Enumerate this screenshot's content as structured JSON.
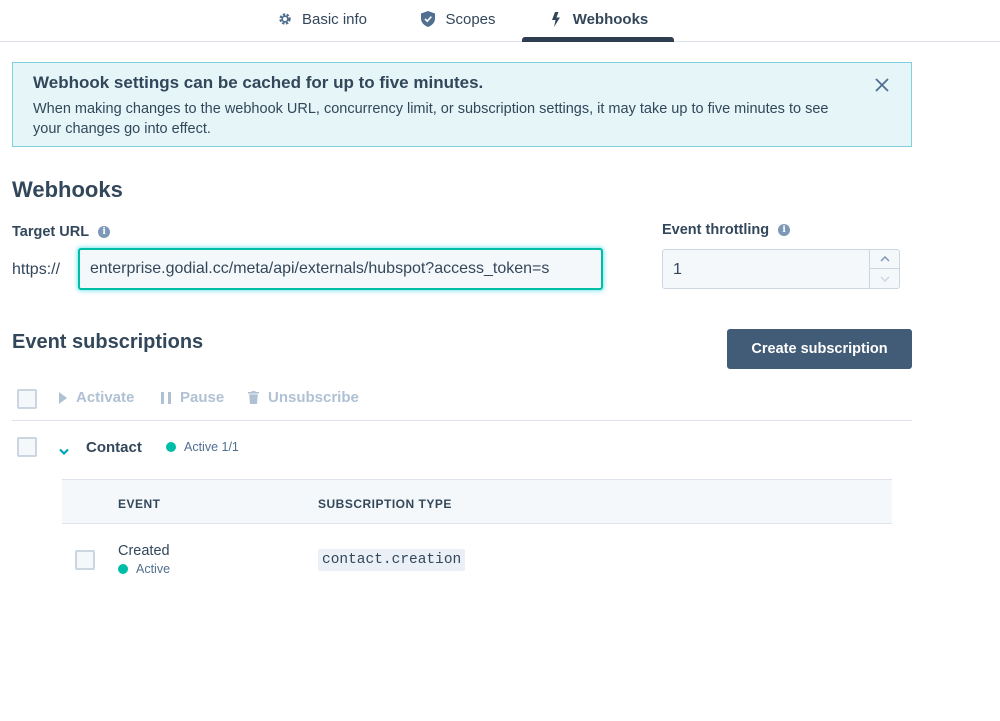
{
  "tabs": [
    {
      "label": "Basic info",
      "icon": "gear-icon"
    },
    {
      "label": "Scopes",
      "icon": "shield-icon"
    },
    {
      "label": "Webhooks",
      "icon": "lightning-icon",
      "active": true
    }
  ],
  "alert": {
    "title": "Webhook settings can be cached for up to five minutes.",
    "body": "When making changes to the webhook URL, concurrency limit, or subscription settings, it may take up to five minutes to see your changes go into effect."
  },
  "webhooks": {
    "title": "Webhooks",
    "target_url_label": "Target URL",
    "url_prefix": "https://",
    "url_value": "enterprise.godial.cc/meta/api/externals/hubspot?access_token=s",
    "throttling_label": "Event throttling",
    "throttling_value": "1"
  },
  "subscriptions": {
    "title": "Event subscriptions",
    "create_label": "Create subscription",
    "actions": {
      "activate": "Activate",
      "pause": "Pause",
      "unsubscribe": "Unsubscribe"
    },
    "group": {
      "name": "Contact",
      "status": "Active 1/1"
    },
    "columns": {
      "event": "EVENT",
      "type": "SUBSCRIPTION TYPE"
    },
    "rows": [
      {
        "event": "Created",
        "status": "Active",
        "type": "contact.creation"
      }
    ]
  },
  "colors": {
    "accent": "#00bda5",
    "primary_button": "#425b76",
    "alert_bg": "#e5f5f8",
    "text": "#33475b"
  }
}
